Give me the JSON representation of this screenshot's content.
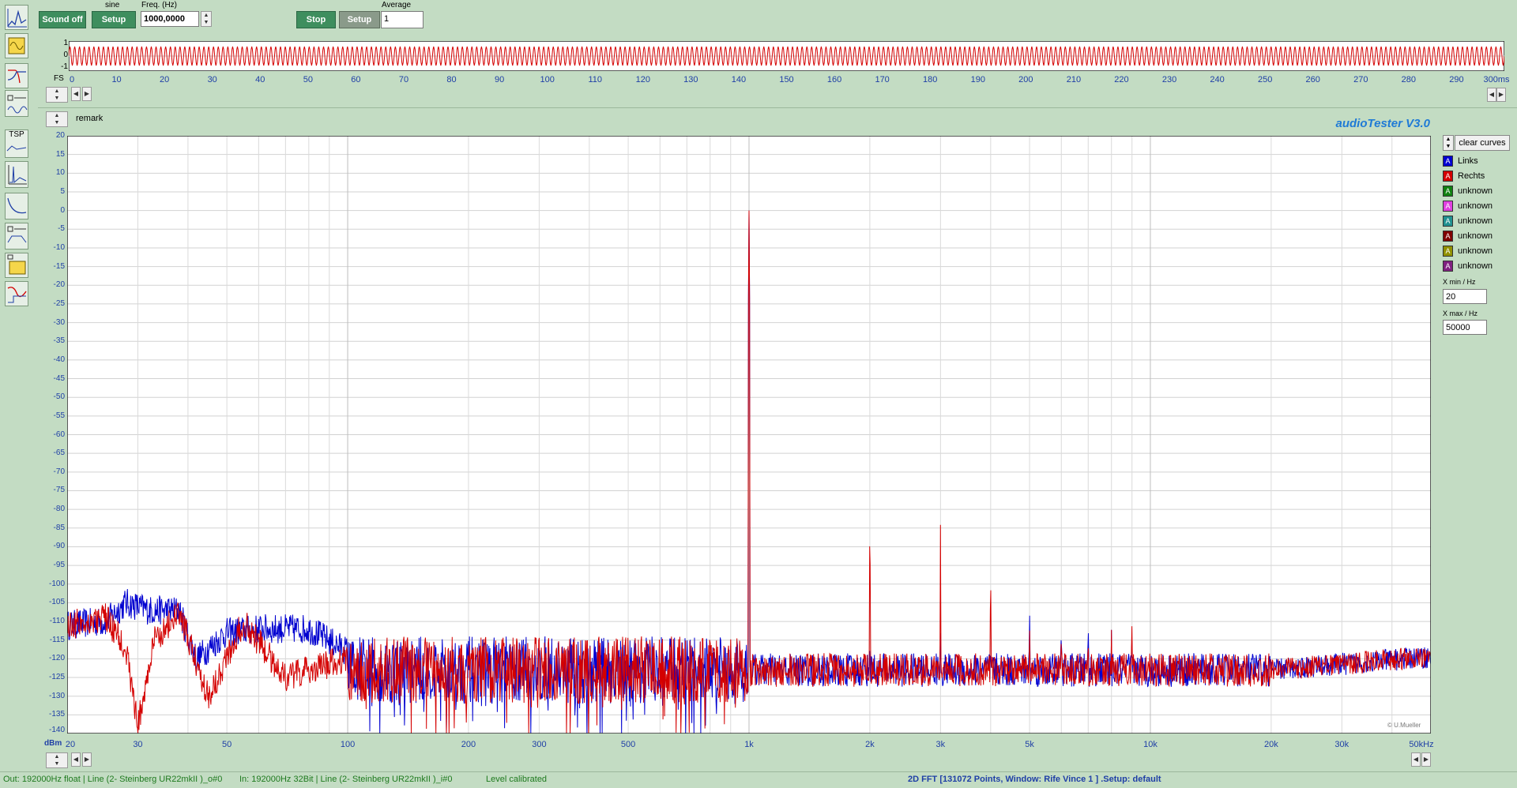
{
  "toolbar": {
    "sound_button": "Sound off",
    "signal_type": "sine",
    "gen_setup": "Setup",
    "freq_label": "Freq. (Hz)",
    "freq_value": "1000,0000",
    "stop_button": "Stop",
    "analyzer_setup": "Setup",
    "average_label": "Average",
    "average_value": "1"
  },
  "scope": {
    "y_ticks": [
      "1",
      "0",
      "-1"
    ],
    "fs_label": "FS",
    "x_ticks": [
      "0",
      "10",
      "20",
      "30",
      "40",
      "50",
      "60",
      "70",
      "80",
      "90",
      "100",
      "110",
      "120",
      "130",
      "140",
      "150",
      "160",
      "170",
      "180",
      "190",
      "200",
      "210",
      "220",
      "230",
      "240",
      "250",
      "260",
      "270",
      "280",
      "290",
      "300ms"
    ],
    "trace_color": "#d40000"
  },
  "main": {
    "remark_label": "remark",
    "app_title": "audioTester  V3.0",
    "y_unit": "dBm",
    "y_ticks": [
      "20",
      "15",
      "10",
      "5",
      "0",
      "-5",
      "-10",
      "-15",
      "-20",
      "-25",
      "-30",
      "-35",
      "-40",
      "-45",
      "-50",
      "-55",
      "-60",
      "-65",
      "-70",
      "-75",
      "-80",
      "-85",
      "-90",
      "-95",
      "-100",
      "-105",
      "-110",
      "-115",
      "-120",
      "-125",
      "-130",
      "-135",
      "-140"
    ],
    "x_ticks": [
      "20",
      "30",
      "50",
      "100",
      "200",
      "300",
      "500",
      "1k",
      "2k",
      "3k",
      "5k",
      "10k",
      "20k",
      "30k",
      "50kHz"
    ],
    "copyright": "© U.Mueller"
  },
  "chart_data": {
    "type": "line",
    "title": "2D FFT [131072 Points, Window: Rife Vince 1 ]",
    "xlabel": "Hz",
    "ylabel": "dBm",
    "xscale": "log",
    "xlim": [
      20,
      50000
    ],
    "ylim": [
      -140,
      20
    ],
    "grid": true,
    "legend_position": "right",
    "noise_floor_dbm": -123,
    "series": [
      {
        "name": "Links",
        "color": "#0000d0",
        "peaks": [
          {
            "x": 1000,
            "y": 0
          },
          {
            "x": 2000,
            "y": -113
          },
          {
            "x": 3000,
            "y": -112
          },
          {
            "x": 4000,
            "y": -115
          },
          {
            "x": 5000,
            "y": -106
          },
          {
            "x": 6000,
            "y": -109
          },
          {
            "x": 7000,
            "y": -108
          },
          {
            "x": 8000,
            "y": -112
          },
          {
            "x": 9000,
            "y": -113
          },
          {
            "x": 700,
            "y": -115
          }
        ],
        "low_freq": [
          {
            "x": 20,
            "y": -111
          },
          {
            "x": 25,
            "y": -110
          },
          {
            "x": 28,
            "y": -105
          },
          {
            "x": 32,
            "y": -107
          },
          {
            "x": 38,
            "y": -107
          },
          {
            "x": 42,
            "y": -120
          },
          {
            "x": 50,
            "y": -113
          },
          {
            "x": 60,
            "y": -112
          },
          {
            "x": 80,
            "y": -112
          },
          {
            "x": 100,
            "y": -118
          }
        ]
      },
      {
        "name": "Rechts",
        "color": "#d40000",
        "peaks": [
          {
            "x": 1000,
            "y": 0
          },
          {
            "x": 2000,
            "y": -85
          },
          {
            "x": 3000,
            "y": -83
          },
          {
            "x": 4000,
            "y": -97
          },
          {
            "x": 5000,
            "y": -110
          },
          {
            "x": 6000,
            "y": -110
          },
          {
            "x": 7000,
            "y": -112
          },
          {
            "x": 8000,
            "y": -112
          },
          {
            "x": 9000,
            "y": -109
          }
        ],
        "low_freq": [
          {
            "x": 20,
            "y": -111
          },
          {
            "x": 25,
            "y": -109
          },
          {
            "x": 28,
            "y": -117
          },
          {
            "x": 30,
            "y": -138
          },
          {
            "x": 33,
            "y": -115
          },
          {
            "x": 38,
            "y": -108
          },
          {
            "x": 45,
            "y": -130
          },
          {
            "x": 55,
            "y": -110
          },
          {
            "x": 70,
            "y": -125
          },
          {
            "x": 100,
            "y": -120
          }
        ]
      }
    ]
  },
  "legend": {
    "clear_button": "clear curves",
    "items": [
      {
        "label": "Links",
        "color": "#0000d0"
      },
      {
        "label": "Rechts",
        "color": "#d40000"
      },
      {
        "label": "unknown",
        "color": "#108010"
      },
      {
        "label": "unknown",
        "color": "#e040e0"
      },
      {
        "label": "unknown",
        "color": "#209090"
      },
      {
        "label": "unknown",
        "color": "#800000"
      },
      {
        "label": "unknown",
        "color": "#909000"
      },
      {
        "label": "unknown",
        "color": "#802080"
      }
    ],
    "xmin_label": "X min / Hz",
    "xmin_value": "20",
    "xmax_label": "X max / Hz",
    "xmax_value": "50000"
  },
  "status": {
    "out": "Out: 192000Hz float  | Line (2- Steinberg UR22mkII )_o#0",
    "in": "In: 192000Hz 32Bit  | Line (2- Steinberg UR22mkII )_i#0",
    "level": "Level calibrated",
    "fft": "2D FFT [131072 Points, Window: Rife Vince 1 ]  .Setup:  default"
  }
}
